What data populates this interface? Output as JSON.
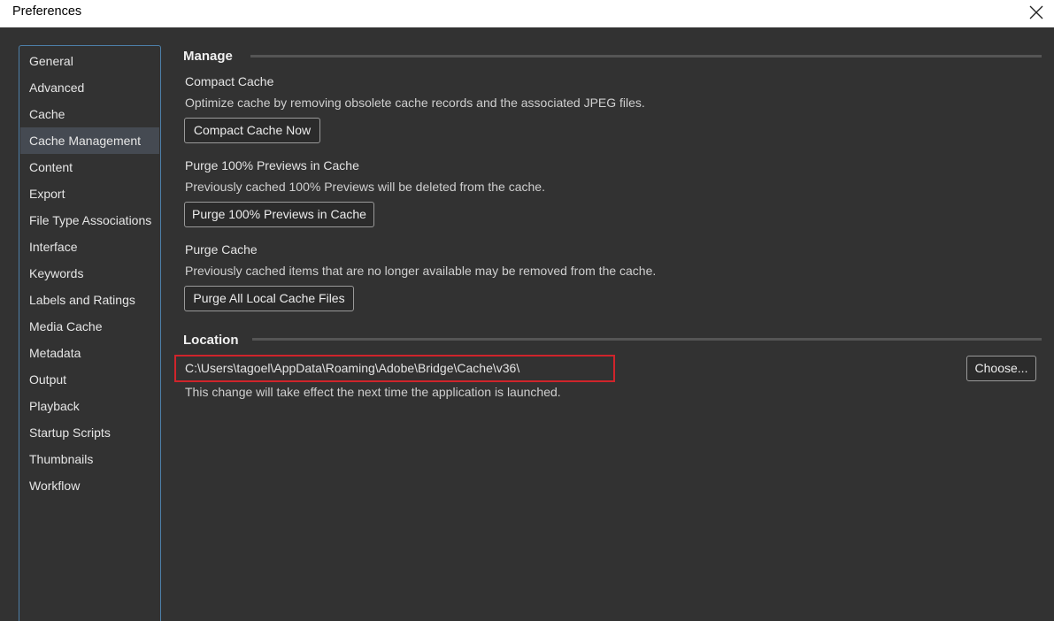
{
  "window": {
    "title": "Preferences"
  },
  "sidebar": {
    "items": [
      {
        "label": "General"
      },
      {
        "label": "Advanced"
      },
      {
        "label": "Cache"
      },
      {
        "label": "Cache Management"
      },
      {
        "label": "Content"
      },
      {
        "label": "Export"
      },
      {
        "label": "File Type Associations"
      },
      {
        "label": "Interface"
      },
      {
        "label": "Keywords"
      },
      {
        "label": "Labels and Ratings"
      },
      {
        "label": "Media Cache"
      },
      {
        "label": "Metadata"
      },
      {
        "label": "Output"
      },
      {
        "label": "Playback"
      },
      {
        "label": "Startup Scripts"
      },
      {
        "label": "Thumbnails"
      },
      {
        "label": "Workflow"
      }
    ],
    "selected": "Cache Management"
  },
  "manage": {
    "title": "Manage",
    "compact": {
      "label": "Compact Cache",
      "description": "Optimize cache by removing obsolete cache records and the associated JPEG files.",
      "button": "Compact Cache Now"
    },
    "purge_previews": {
      "label": "Purge 100% Previews in Cache",
      "description": "Previously cached 100% Previews will be deleted from the cache.",
      "button": "Purge 100% Previews in Cache"
    },
    "purge_cache": {
      "label": "Purge Cache",
      "description": "Previously cached items that are no longer available may be removed from the cache.",
      "button": "Purge All Local Cache Files"
    }
  },
  "location": {
    "title": "Location",
    "path": "C:\\Users\\tagoel\\AppData\\Roaming\\Adobe\\Bridge\\Cache\\v36\\",
    "note": "This change will take effect the next time the application is launched.",
    "choose_button": "Choose..."
  },
  "colors": {
    "background": "#323232",
    "sidebar_border": "#4d7fa8",
    "selected_item": "#454a52",
    "highlight_box": "#d0242b"
  },
  "icons": {
    "close": "close-icon"
  }
}
